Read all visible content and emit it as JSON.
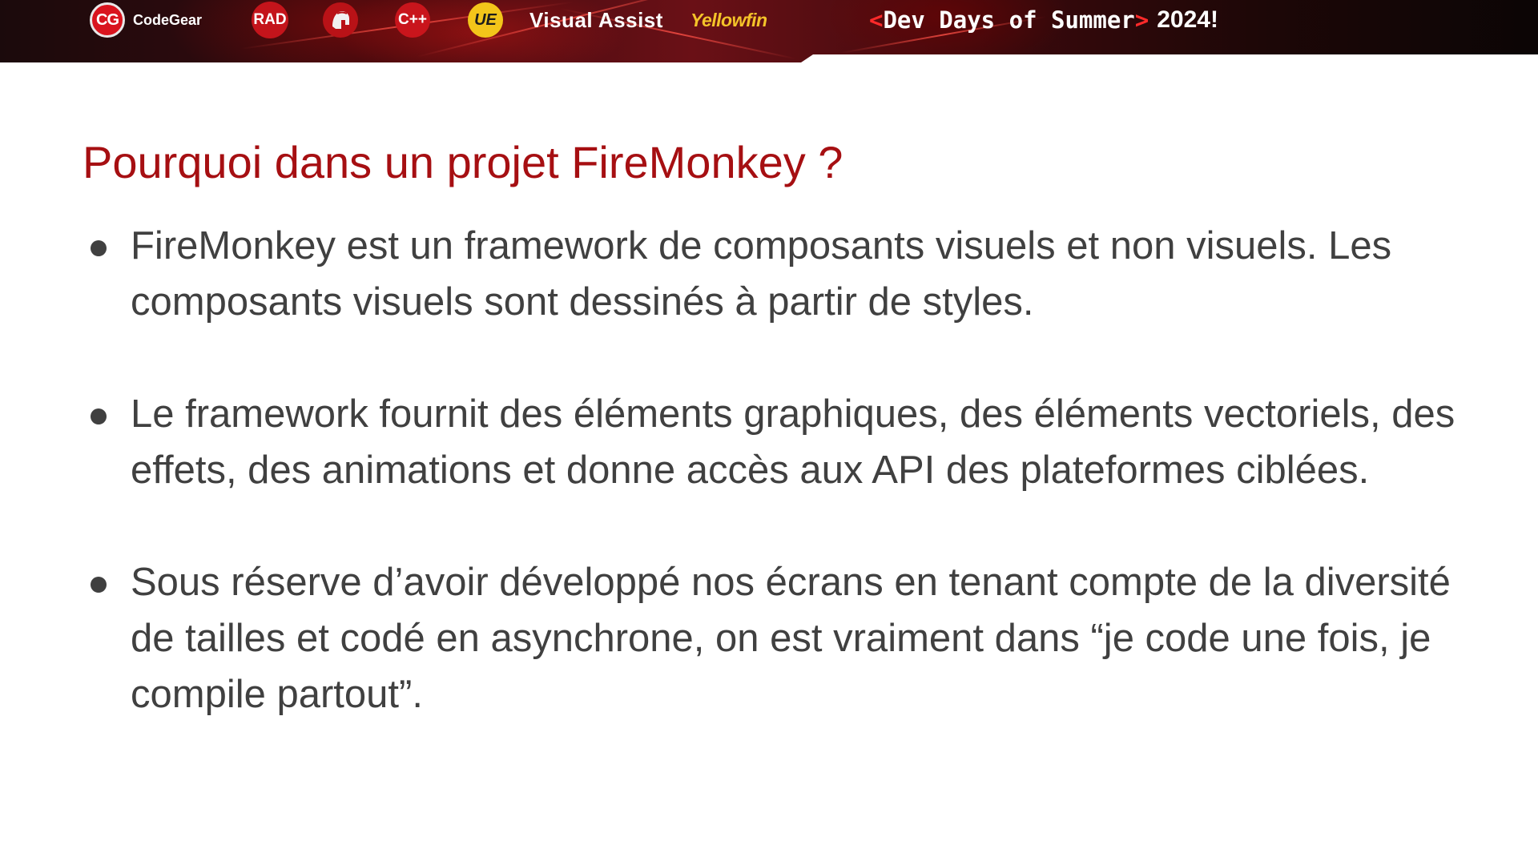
{
  "banner": {
    "codegear_badge": "CG",
    "codegear_label": "CodeGear",
    "rad_label": "RAD",
    "cpp_label": "C++",
    "ue_label": "UE",
    "visual_assist_label": "Visual Assist",
    "yellowfin_label": "Yellowfin",
    "event_bracket_open": "<",
    "event_name": "Dev Days of Summer",
    "event_bracket_close": ">",
    "event_year": "2024!",
    "colors": {
      "accent_red": "#ff2a2a",
      "ue_yellow": "#f3c51a",
      "yellowfin_yellow": "#f4c329"
    },
    "icons": [
      "codegear-logo-icon",
      "rad-logo-icon",
      "spartan-helmet-icon",
      "cpp-logo-icon",
      "ue-logo-icon",
      "yellowfin-logo-icon"
    ]
  },
  "slide": {
    "title": "Pourquoi dans un projet FireMonkey ?",
    "title_color": "#a60f12",
    "text_color": "#404040",
    "bullets": [
      {
        "text": "FireMonkey est un framework de composants visuels et non visuels. Les composants visuels sont dessinés à partir de styles."
      },
      {
        "text": "Le framework fournit des éléments graphiques, des éléments vectoriels, des effets, des animations et donne accès aux API des plateformes ciblées."
      },
      {
        "text": "Sous réserve d’avoir développé nos écrans en tenant compte de la diversité de tailles et codé en asynchrone, on est vraiment dans “je code une fois, je compile partout”."
      }
    ]
  }
}
